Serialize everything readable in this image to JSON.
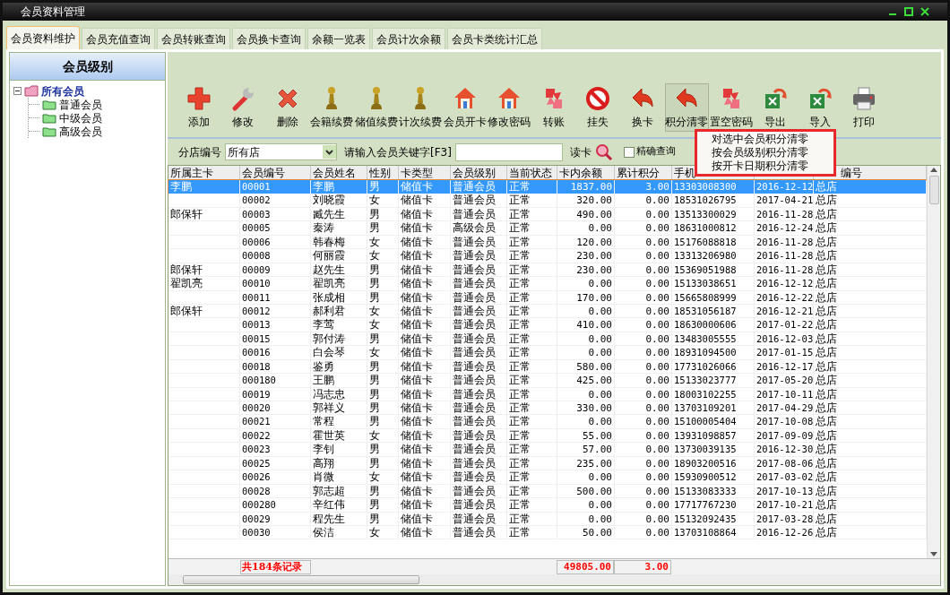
{
  "window": {
    "title": "会员资料管理"
  },
  "tabs": [
    {
      "label": "会员资料维护",
      "selected": true
    },
    {
      "label": "会员充值查询",
      "selected": false
    },
    {
      "label": "会员转账查询",
      "selected": false
    },
    {
      "label": "会员换卡查询",
      "selected": false
    },
    {
      "label": "余额一览表",
      "selected": false
    },
    {
      "label": "会员计次余额",
      "selected": false
    },
    {
      "label": "会员卡类统计汇总",
      "selected": false
    }
  ],
  "sidebar": {
    "title": "会员级别",
    "tree": [
      {
        "label": "所有会员",
        "expanded": true,
        "children": [
          {
            "label": "普通会员"
          },
          {
            "label": "中级会员"
          },
          {
            "label": "高级会员"
          }
        ]
      }
    ]
  },
  "toolbar": [
    {
      "label": "添加",
      "kind": "add",
      "pressed": false
    },
    {
      "label": "修改",
      "kind": "edit",
      "pressed": false
    },
    {
      "label": "删除",
      "kind": "delete",
      "pressed": false
    },
    {
      "label": "会籍续费",
      "kind": "pawn",
      "pressed": false
    },
    {
      "label": "储值续费",
      "kind": "pawn",
      "pressed": false
    },
    {
      "label": "计次续费",
      "kind": "pawn",
      "pressed": false
    },
    {
      "label": "会员开卡",
      "kind": "house",
      "pressed": false
    },
    {
      "label": "修改密码",
      "kind": "house",
      "pressed": false
    },
    {
      "label": "转账",
      "kind": "swap",
      "pressed": false
    },
    {
      "label": "挂失",
      "kind": "stop",
      "pressed": false
    },
    {
      "label": "换卡",
      "kind": "arrow",
      "pressed": false
    },
    {
      "label": "积分清零",
      "kind": "arrow",
      "pressed": true
    },
    {
      "label": "置空密码",
      "kind": "swap",
      "pressed": false
    },
    {
      "label": "导出",
      "kind": "sheet",
      "pressed": false
    },
    {
      "label": "导入",
      "kind": "sheet",
      "pressed": false
    },
    {
      "label": "打印",
      "kind": "print",
      "pressed": false
    }
  ],
  "dropdown_menu": {
    "items": [
      "对选中会员积分清零",
      "按会员级别积分清零",
      "按开卡日期积分清零"
    ]
  },
  "filter": {
    "store_label": "分店编号",
    "store_value": "所有店",
    "keyword_label": "请输入会员关键字[F3]",
    "read_card_label": "读卡",
    "exact_checkbox": {
      "label": "精确查询",
      "checked": false
    }
  },
  "table": {
    "columns": [
      "所属主卡",
      "会员编号",
      "会员姓名",
      "性别",
      "卡类型",
      "会员级别",
      "当前状态",
      "卡内余额",
      "累计积分",
      "手机",
      null,
      "编号"
    ],
    "rows": [
      {
        "selected": true,
        "cells": [
          "李鹏",
          "00001",
          "李鹏",
          "男",
          "储值卡",
          "普通会员",
          "正常",
          "1837.00",
          "3.00",
          "13303008300",
          "2016-12-12",
          "总店"
        ]
      },
      {
        "selected": false,
        "cells": [
          null,
          "00002",
          "刘晓霞",
          "女",
          "储值卡",
          "普通会员",
          "正常",
          "320.00",
          "0.00",
          "18531026795",
          "2017-04-21",
          "总店"
        ]
      },
      {
        "selected": false,
        "cells": [
          "郎保轩",
          "00003",
          "臧先生",
          "男",
          "储值卡",
          "普通会员",
          "正常",
          "490.00",
          "0.00",
          "13513300029",
          "2016-11-28",
          "总店"
        ]
      },
      {
        "selected": false,
        "cells": [
          null,
          "00005",
          "秦涛",
          "男",
          "储值卡",
          "高级会员",
          "正常",
          "0.00",
          "0.00",
          "18631000812",
          "2016-12-24",
          "总店"
        ]
      },
      {
        "selected": false,
        "cells": [
          null,
          "00006",
          "韩春梅",
          "女",
          "储值卡",
          "普通会员",
          "正常",
          "120.00",
          "0.00",
          "15176088818",
          "2016-11-28",
          "总店"
        ]
      },
      {
        "selected": false,
        "cells": [
          null,
          "00008",
          "何丽霞",
          "女",
          "储值卡",
          "普通会员",
          "正常",
          "230.00",
          "0.00",
          "13313206980",
          "2016-11-28",
          "总店"
        ]
      },
      {
        "selected": false,
        "cells": [
          "郎保轩",
          "00009",
          "赵先生",
          "男",
          "储值卡",
          "普通会员",
          "正常",
          "230.00",
          "0.00",
          "15369051988",
          "2016-11-28",
          "总店"
        ]
      },
      {
        "selected": false,
        "cells": [
          "翟凯亮",
          "00010",
          "翟凯亮",
          "男",
          "储值卡",
          "普通会员",
          "正常",
          "0.00",
          "0.00",
          "15133038651",
          "2016-12-12",
          "总店"
        ]
      },
      {
        "selected": false,
        "cells": [
          null,
          "00011",
          "张成相",
          "男",
          "储值卡",
          "普通会员",
          "正常",
          "170.00",
          "0.00",
          "15665808999",
          "2016-12-22",
          "总店"
        ]
      },
      {
        "selected": false,
        "cells": [
          "郎保轩",
          "00012",
          "郝利君",
          "女",
          "储值卡",
          "普通会员",
          "正常",
          "0.00",
          "0.00",
          "18531056187",
          "2016-12-21",
          "总店"
        ]
      },
      {
        "selected": false,
        "cells": [
          null,
          "00013",
          "李莺",
          "女",
          "储值卡",
          "普通会员",
          "正常",
          "410.00",
          "0.00",
          "18630000606",
          "2017-01-22",
          "总店"
        ]
      },
      {
        "selected": false,
        "cells": [
          null,
          "00015",
          "郭付涛",
          "男",
          "储值卡",
          "普通会员",
          "正常",
          "0.00",
          "0.00",
          "13483005555",
          "2016-12-03",
          "总店"
        ]
      },
      {
        "selected": false,
        "cells": [
          null,
          "00016",
          "白会琴",
          "女",
          "储值卡",
          "普通会员",
          "正常",
          "0.00",
          "0.00",
          "18931094500",
          "2017-01-15",
          "总店"
        ]
      },
      {
        "selected": false,
        "cells": [
          null,
          "00018",
          "鉴勇",
          "男",
          "储值卡",
          "普通会员",
          "正常",
          "580.00",
          "0.00",
          "17731026066",
          "2016-12-17",
          "总店"
        ]
      },
      {
        "selected": false,
        "cells": [
          null,
          "000180",
          "王鹏",
          "男",
          "储值卡",
          "普通会员",
          "正常",
          "425.00",
          "0.00",
          "15133023777",
          "2017-05-20",
          "总店"
        ]
      },
      {
        "selected": false,
        "cells": [
          null,
          "00019",
          "冯志忠",
          "男",
          "储值卡",
          "普通会员",
          "正常",
          "0.00",
          "0.00",
          "18003102255",
          "2017-10-11",
          "总店"
        ]
      },
      {
        "selected": false,
        "cells": [
          null,
          "00020",
          "郭祥义",
          "男",
          "储值卡",
          "普通会员",
          "正常",
          "330.00",
          "0.00",
          "13703109201",
          "2017-04-29",
          "总店"
        ]
      },
      {
        "selected": false,
        "cells": [
          null,
          "00021",
          "常程",
          "男",
          "储值卡",
          "普通会员",
          "正常",
          "0.00",
          "0.00",
          "15100005404",
          "2017-10-08",
          "总店"
        ]
      },
      {
        "selected": false,
        "cells": [
          null,
          "00022",
          "霍世英",
          "女",
          "储值卡",
          "普通会员",
          "正常",
          "55.00",
          "0.00",
          "13931098857",
          "2017-09-09",
          "总店"
        ]
      },
      {
        "selected": false,
        "cells": [
          null,
          "00023",
          "李钊",
          "男",
          "储值卡",
          "普通会员",
          "正常",
          "57.00",
          "0.00",
          "13730039135",
          "2016-12-30",
          "总店"
        ]
      },
      {
        "selected": false,
        "cells": [
          null,
          "00025",
          "高翔",
          "男",
          "储值卡",
          "普通会员",
          "正常",
          "235.00",
          "0.00",
          "18903200516",
          "2017-08-06",
          "总店"
        ]
      },
      {
        "selected": false,
        "cells": [
          null,
          "00026",
          "肖微",
          "女",
          "储值卡",
          "普通会员",
          "正常",
          "0.00",
          "0.00",
          "15930900512",
          "2017-03-02",
          "总店"
        ]
      },
      {
        "selected": false,
        "cells": [
          null,
          "00028",
          "郭志超",
          "男",
          "储值卡",
          "普通会员",
          "正常",
          "500.00",
          "0.00",
          "15133083333",
          "2017-10-13",
          "总店"
        ]
      },
      {
        "selected": false,
        "cells": [
          null,
          "000280",
          "辛红伟",
          "男",
          "储值卡",
          "普通会员",
          "正常",
          "0.00",
          "0.00",
          "17717767230",
          "2017-10-21",
          "总店"
        ]
      },
      {
        "selected": false,
        "cells": [
          null,
          "00029",
          "程先生",
          "男",
          "储值卡",
          "普通会员",
          "正常",
          "0.00",
          "0.00",
          "15132092435",
          "2017-03-28",
          "总店"
        ]
      },
      {
        "selected": false,
        "cells": [
          null,
          "00030",
          "侯洁",
          "女",
          "储值卡",
          "普通会员",
          "正常",
          "50.00",
          "0.00",
          "13703108864",
          "2016-12-26",
          "总店"
        ]
      }
    ],
    "footer": {
      "record_count": "共184条记录",
      "balance_total": "49805.00",
      "points_total": "3.00"
    }
  }
}
